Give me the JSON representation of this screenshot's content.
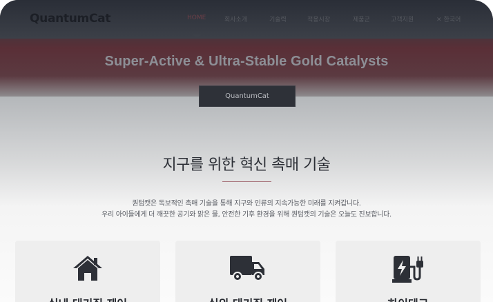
{
  "nav": {
    "logo": "QuantumCat",
    "items": [
      {
        "label": "HOME",
        "active": true
      },
      {
        "label": "회사소개"
      },
      {
        "label": "기술력"
      },
      {
        "label": "적용시장"
      },
      {
        "label": "제품군"
      },
      {
        "label": "고객지원"
      },
      {
        "label": "한국어",
        "icon": "globe-icon"
      }
    ]
  },
  "hero": {
    "title": "Super-Active & Ultra-Stable Gold Catalysts",
    "button_label": "QuantumCat"
  },
  "section": {
    "title": "지구를 위한 혁신 촉매 기술",
    "intro_lines": [
      "퀀텀캣은 독보적인 촉매 기술을 통해 지구와 인류의 지속가능한 미래를 지켜갑니다.",
      "우리 아이들에게 더 깨끗한 공기와 맑은 물, 안전한 기후 환경을 위해 퀀텀캣의 기술은 오늘도 진보합니다."
    ]
  },
  "cards": [
    {
      "label": "실내 대기질 제어",
      "icon": "house-icon"
    },
    {
      "label": "실외 대기질 제어",
      "icon": "truck-icon"
    },
    {
      "label": "하이테크",
      "icon": "ev-charger-icon"
    }
  ],
  "colors": {
    "nav_bg": "#2a2e37",
    "hero_band": "#5a2f37",
    "accent": "#a36a72",
    "card_bg": "#eeeeee"
  }
}
